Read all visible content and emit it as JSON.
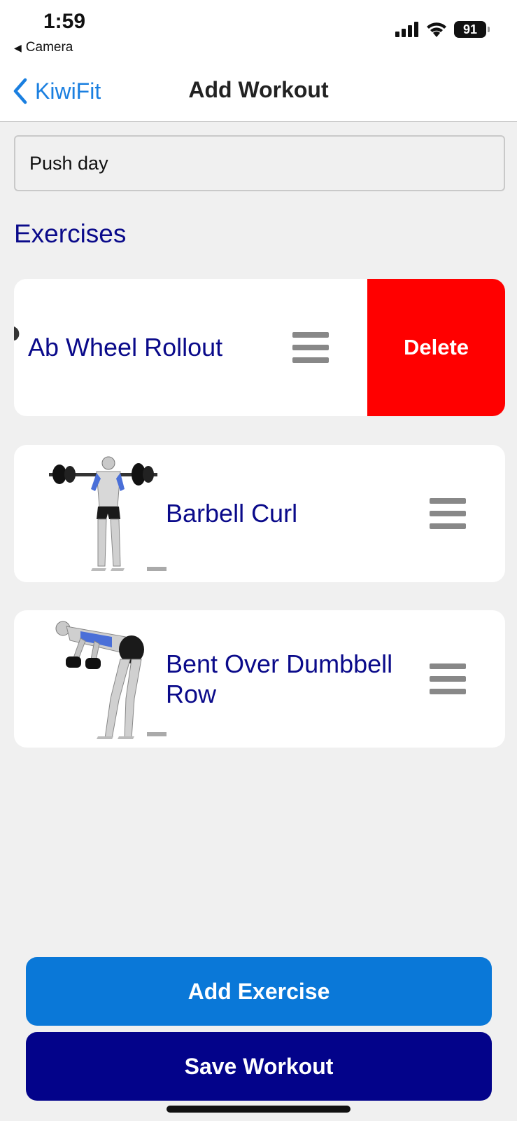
{
  "status_bar": {
    "time": "1:59",
    "back_app": "Camera",
    "battery": "91",
    "icons": [
      "signal-icon",
      "wifi-icon",
      "battery-icon"
    ]
  },
  "nav": {
    "back_label": "KiwiFit",
    "title": "Add Workout"
  },
  "workout_name": {
    "value": "Push day"
  },
  "exercises_title": "Exercises",
  "exercises": [
    {
      "name": "Ab Wheel Rollout",
      "swiped": true,
      "action": "Delete"
    },
    {
      "name": "Barbell Curl",
      "swiped": false
    },
    {
      "name": "Bent Over Dumbbell Row",
      "swiped": false
    }
  ],
  "buttons": {
    "add_exercise": "Add Exercise",
    "save_workout": "Save Workout"
  },
  "colors": {
    "accent_blue": "#0a78d8",
    "navy": "#03038a",
    "text_navy": "#0a0a8a",
    "delete_red": "#ff0000",
    "link_blue": "#1a7fe0"
  }
}
